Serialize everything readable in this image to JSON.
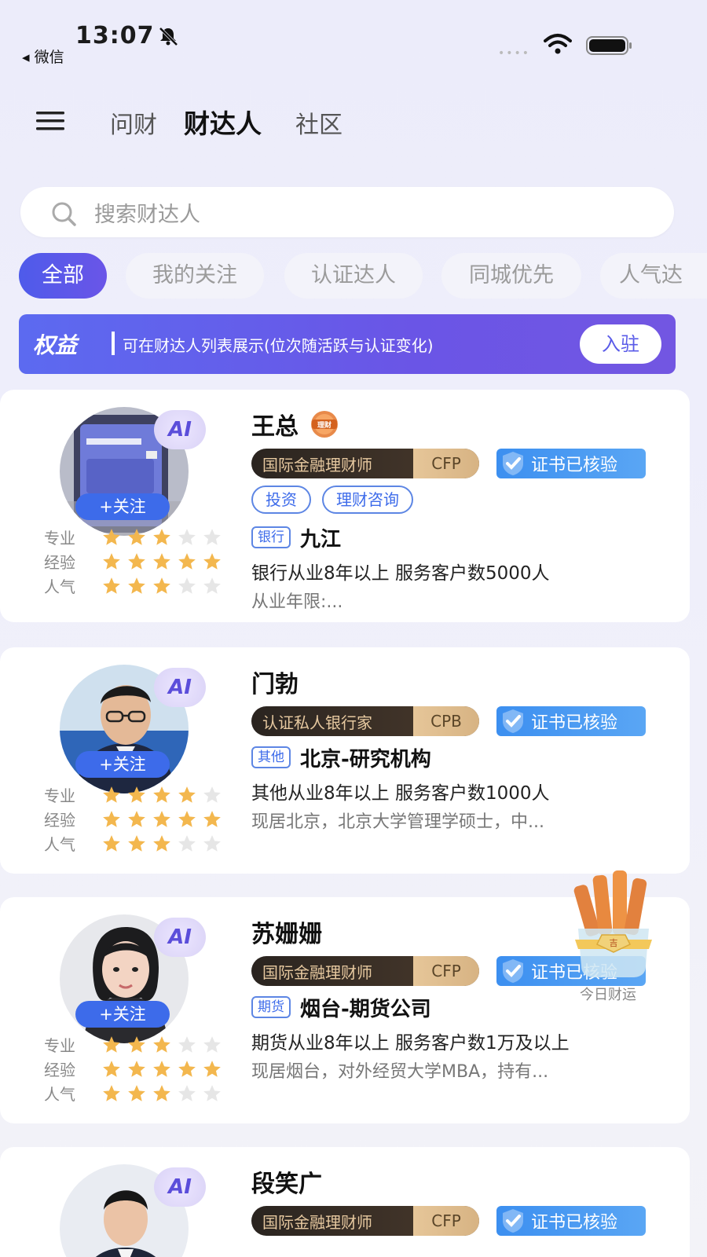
{
  "status_bar": {
    "time": "13:07",
    "back_app": "◂ 微信"
  },
  "nav": {
    "tabs": [
      {
        "label": "问财"
      },
      {
        "label": "财达人"
      },
      {
        "label": "社区"
      }
    ]
  },
  "search": {
    "placeholder": "搜索财达人"
  },
  "filters": [
    {
      "label": "全部"
    },
    {
      "label": "我的关注"
    },
    {
      "label": "认证达人"
    },
    {
      "label": "同城优先"
    },
    {
      "label": "人气达"
    }
  ],
  "banner": {
    "tag": "权益",
    "text": "可在财达人列表展示(位次随活跃与认证变化)",
    "button": "入驻"
  },
  "ui": {
    "follow": "+关注",
    "ai": "AI",
    "verified": "证书已核验",
    "rating_labels": [
      "专业",
      "经验",
      "人气"
    ],
    "licai_badge": "理财"
  },
  "advisors": [
    {
      "name": "王总",
      "has_licai_badge": true,
      "cert_title": "国际金融理财师",
      "cert_abbr": "CFP",
      "tags": [
        "投资",
        "理财咨询"
      ],
      "org_type": "银行",
      "org_name": "九江",
      "desc1": "银行从业8年以上 服务客户数5000人",
      "desc2": "从业年限:...",
      "ratings": {
        "专业": 3,
        "经验": 5,
        "人气": 3
      }
    },
    {
      "name": "门勃",
      "has_licai_badge": false,
      "cert_title": "认证私人银行家",
      "cert_abbr": "CPB",
      "tags": [],
      "org_type": "其他",
      "org_name": "北京-研究机构",
      "desc1": "其他从业8年以上 服务客户数1000人",
      "desc2": "现居北京，北京大学管理学硕士，中...",
      "ratings": {
        "专业": 4,
        "经验": 5,
        "人气": 3
      }
    },
    {
      "name": "苏姗姗",
      "has_licai_badge": false,
      "cert_title": "国际金融理财师",
      "cert_abbr": "CFP",
      "tags": [],
      "org_type": "期货",
      "org_name": "烟台-期货公司",
      "desc1": "期货从业8年以上 服务客户数1万及以上",
      "desc2": "现居烟台，对外经贸大学MBA，持有...",
      "ratings": {
        "专业": 3,
        "经验": 5,
        "人气": 3
      }
    },
    {
      "name": "段笑广",
      "has_licai_badge": false,
      "cert_title": "国际金融理财师",
      "cert_abbr": "CFP",
      "tags": [],
      "org_type": "",
      "org_name": "",
      "desc1": "",
      "desc2": "",
      "ratings": {}
    }
  ],
  "fortune_widget": {
    "label": "今日财运",
    "seal": "吉"
  },
  "colors": {
    "accent": "#4E5BEA",
    "follow": "#3D6BEA",
    "star": "#F3B74E",
    "star_off": "#E6E6E6"
  }
}
